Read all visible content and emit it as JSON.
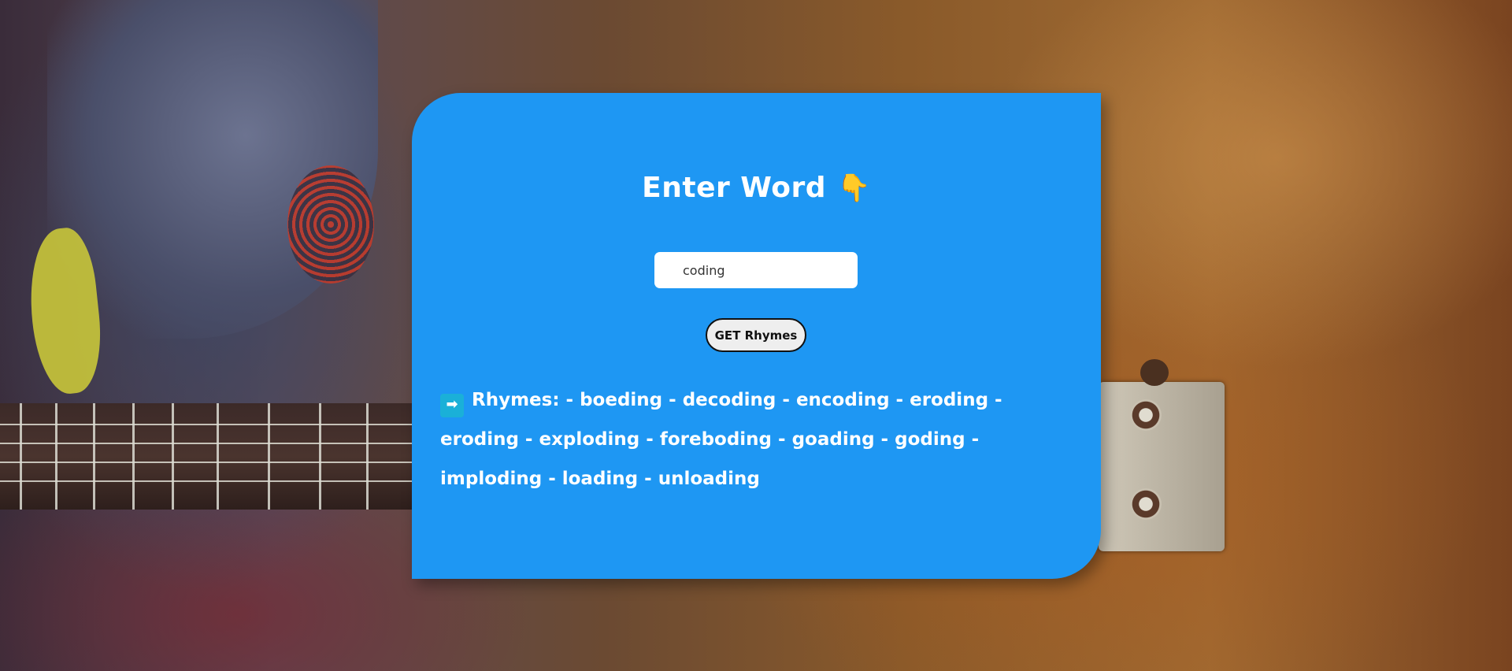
{
  "header": {
    "title": "Enter Word",
    "title_icon": "pointing-down-hand-emoji",
    "title_emoji": "👇"
  },
  "search": {
    "value": "coding",
    "placeholder": ""
  },
  "actions": {
    "get_rhymes_label": "GET Rhymes"
  },
  "result": {
    "icon": "right-arrow-icon",
    "arrow": "➡",
    "text": "Rhymes: - boeding - decoding - encoding - eroding - eroding - exploding - foreboding - goading - goding - imploding - loading - unloading"
  },
  "colors": {
    "card": "#1e97f3",
    "text": "#ffffff",
    "button_bg": "#eeeeee",
    "button_border": "#111111"
  }
}
